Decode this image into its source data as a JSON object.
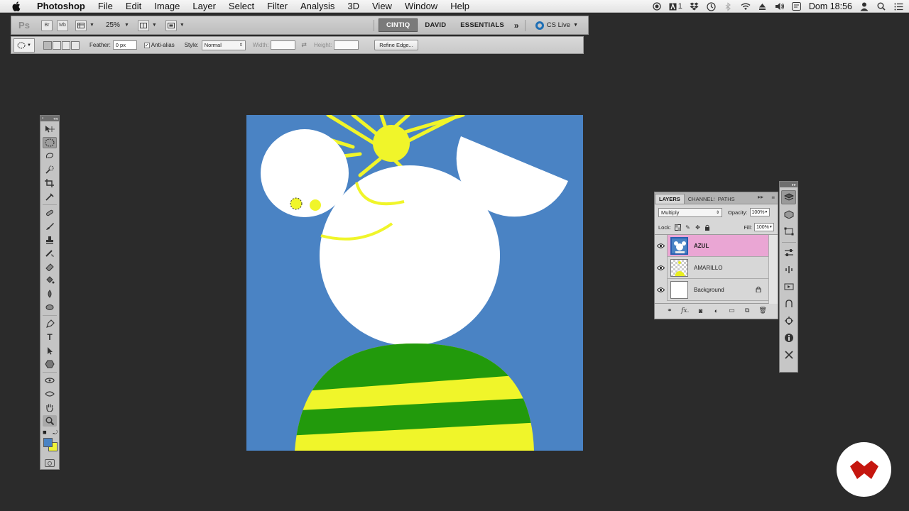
{
  "menubar": {
    "items": [
      "Photoshop",
      "File",
      "Edit",
      "Image",
      "Layer",
      "Select",
      "Filter",
      "Analysis",
      "3D",
      "View",
      "Window",
      "Help"
    ],
    "status": {
      "input_badge": "1",
      "datetime": "Dom 18:56"
    }
  },
  "appbar": {
    "logo": "Ps",
    "bridge_label": "Br",
    "minibridge_label": "Mb",
    "zoom": "25%",
    "workspaces": [
      "CINTIQ",
      "DAVID",
      "ESSENTIALS"
    ],
    "active_workspace": "CINTIQ",
    "more": "»",
    "cslive": "CS Live"
  },
  "options": {
    "feather_label": "Feather:",
    "feather_value": "0 px",
    "antialias_label": "Anti-alias",
    "antialias_checked": true,
    "style_label": "Style:",
    "style_value": "Normal",
    "width_label": "Width:",
    "height_label": "Height:",
    "refine_label": "Refine Edge..."
  },
  "tools": {
    "icons": [
      "move-tool",
      "elliptical-marquee-tool",
      "lasso-tool",
      "quick-selection-tool",
      "crop-tool",
      "eyedropper-tool",
      "spot-healing-tool",
      "brush-tool",
      "clone-stamp-tool",
      "history-brush-tool",
      "eraser-tool",
      "paint-bucket-tool",
      "blur-tool",
      "dodge-tool",
      "pen-tool",
      "type-tool",
      "path-selection-tool",
      "shape-tool",
      "3d-rotate-tool",
      "3d-orbit-tool",
      "hand-tool",
      "zoom-tool"
    ],
    "selected": "elliptical-marquee-tool",
    "foreground_color": "#4a83c4",
    "background_color": "#f0f238"
  },
  "canvas": {
    "colors": {
      "sky": "#4a83c4",
      "yellow": "#f0f52a",
      "green": "#229a0c",
      "white": "#ffffff"
    }
  },
  "layers_panel": {
    "tabs": [
      "LAYERS",
      "CHANNELS",
      "PATHS"
    ],
    "active_tab": "LAYERS",
    "blend_mode": "Multiply",
    "opacity_label": "Opacity:",
    "opacity": "100%",
    "lock_label": "Lock:",
    "fill_label": "Fill:",
    "fill": "100%",
    "layers": [
      {
        "name": "AZUL",
        "active": true,
        "visible": true
      },
      {
        "name": "AMARILLO",
        "active": false,
        "visible": true
      },
      {
        "name": "Background",
        "active": false,
        "visible": true,
        "locked": true
      }
    ]
  },
  "dock": {
    "icons": [
      "layers-icon",
      "3d-icon",
      "transform-icon",
      "adjustments-icon",
      "brush-presets-icon",
      "actions-icon",
      "clone-source-icon",
      "navigator-icon",
      "info-icon",
      "tool-presets-icon"
    ]
  },
  "brand": {
    "color": "#c5160f"
  }
}
